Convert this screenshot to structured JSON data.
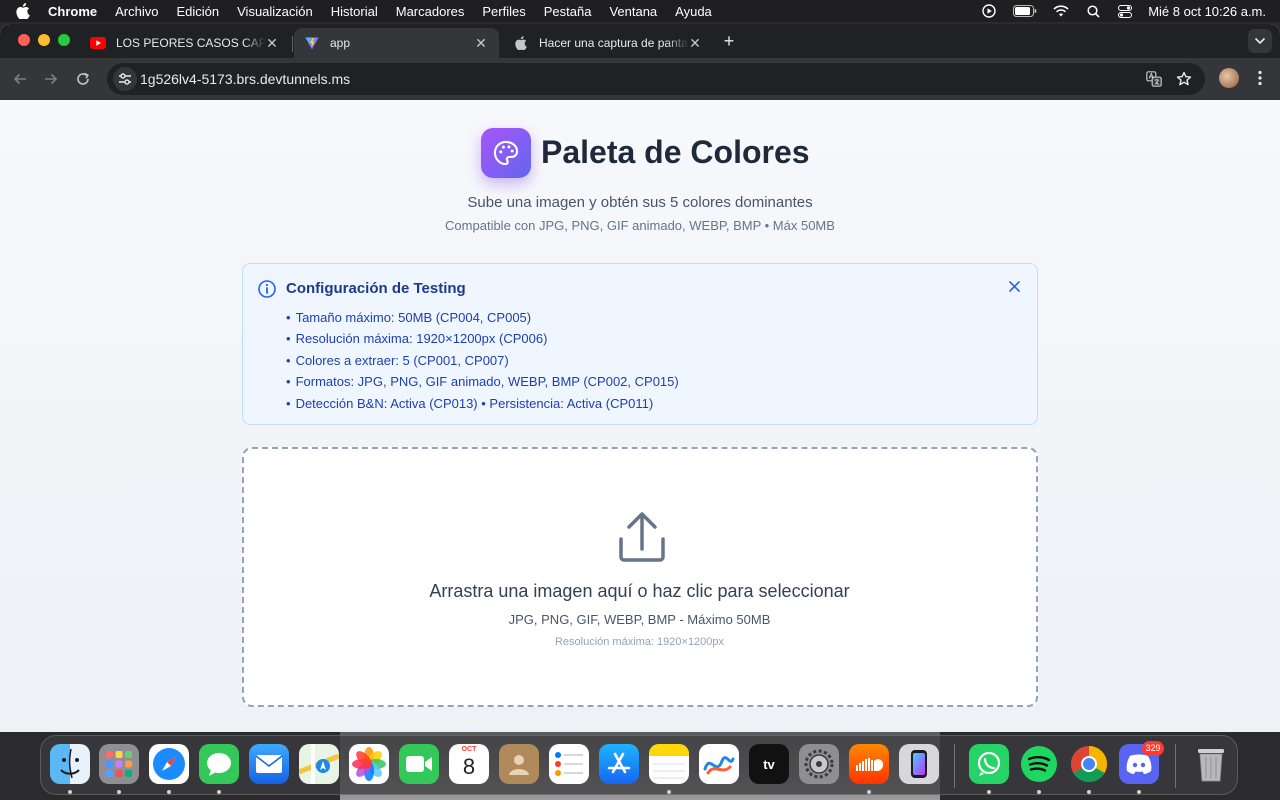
{
  "menubar": {
    "app_name": "Chrome",
    "items": [
      "Archivo",
      "Edición",
      "Visualización",
      "Historial",
      "Marcadores",
      "Perfiles",
      "Pestaña",
      "Ventana",
      "Ayuda"
    ],
    "clock": "Mié 8 oct 10:26 a.m."
  },
  "tabs": [
    {
      "title": "LOS PEORES CASOS CAPTADOS",
      "favicon": "youtube-icon",
      "close": "✕"
    },
    {
      "title": "app",
      "favicon": "vite-icon",
      "close": "✕"
    },
    {
      "title": "Hacer una captura de pantalla",
      "favicon": "apple-icon",
      "close": "✕"
    }
  ],
  "newtab_label": "+",
  "address": {
    "url": "1g526lv4-5173.brs.devtunnels.ms"
  },
  "hero": {
    "title": "Paleta de Colores",
    "subtitle": "Sube una imagen y obtén sus 5 colores dominantes",
    "compat": "Compatible con JPG, PNG, GIF animado, WEBP, BMP • Máx 50MB"
  },
  "config": {
    "title": "Configuración de Testing",
    "items": [
      "Tamaño máximo: 50MB (CP004, CP005)",
      "Resolución máxima: 1920×1200px (CP006)",
      "Colores a extraer: 5 (CP001, CP007)",
      "Formatos: JPG, PNG, GIF animado, WEBP, BMP (CP002, CP015)",
      "Detección B&N: Activa (CP013) • Persistencia: Activa (CP011)"
    ]
  },
  "dropzone": {
    "main": "Arrastra una imagen aquí o haz clic para seleccionar",
    "formats": "JPG, PNG, GIF, WEBP, BMP - Máximo 50MB",
    "resolution": "Resolución máxima: 1920×1200px"
  },
  "dock": {
    "calendar_month": "OCT",
    "calendar_day": "8",
    "tv_label": "tv",
    "discord_badge": "329",
    "apps": [
      "finder",
      "launchpad",
      "safari",
      "messages",
      "mail",
      "maps",
      "photos",
      "facetime",
      "calendar",
      "contacts",
      "reminders",
      "app-store",
      "notes",
      "freeform",
      "apple-tv",
      "system-settings",
      "soundcloud",
      "iphone-mirroring",
      "whatsapp",
      "spotify",
      "chrome",
      "discord",
      "trash"
    ]
  },
  "colors": {
    "accent_gradient_start": "#a855f7",
    "accent_gradient_end": "#6366f1",
    "info_bg": "#eff6ff",
    "info_text": "#1e40af"
  }
}
